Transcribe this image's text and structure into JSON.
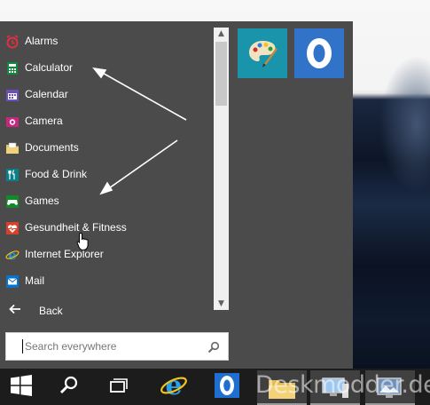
{
  "start_menu": {
    "apps": [
      {
        "label": "Alarms",
        "icon": "alarm-clock-icon",
        "color": "#d0273c"
      },
      {
        "label": "Calculator",
        "icon": "calculator-icon",
        "color": "#10893e"
      },
      {
        "label": "Calendar",
        "icon": "calendar-icon",
        "color": "#6b4fbb"
      },
      {
        "label": "Camera",
        "icon": "camera-icon",
        "color": "#c8277f"
      },
      {
        "label": "Documents",
        "icon": "documents-folder-icon",
        "color": "#e8c76a"
      },
      {
        "label": "Food & Drink",
        "icon": "food-drink-icon",
        "color": "#0a7f8a"
      },
      {
        "label": "Games",
        "icon": "games-controller-icon",
        "color": "#118a29"
      },
      {
        "label": "Gesundheit & Fitness",
        "icon": "health-fitness-icon",
        "color": "#d9402a"
      },
      {
        "label": "Internet Explorer",
        "icon": "internet-explorer-icon",
        "color": "#1e90d6"
      },
      {
        "label": "Mail",
        "icon": "mail-icon",
        "color": "#0a72c9"
      }
    ],
    "back_label": "Back",
    "search": {
      "placeholder": "Search everywhere"
    },
    "tiles": [
      {
        "name": "paint-tile",
        "icon": "paint-palette-icon",
        "color": "#1a94ab"
      },
      {
        "name": "outlook-tile",
        "icon": "outlook-icon",
        "color": "#3173c9"
      }
    ]
  },
  "taskbar": {
    "items": [
      "start-button",
      "search-icon",
      "task-view-icon",
      "internet-explorer-icon",
      "outlook-icon",
      "file-explorer-icon",
      "computer-icon",
      "desktop-icon"
    ]
  },
  "watermark": "Deskmodder.de"
}
